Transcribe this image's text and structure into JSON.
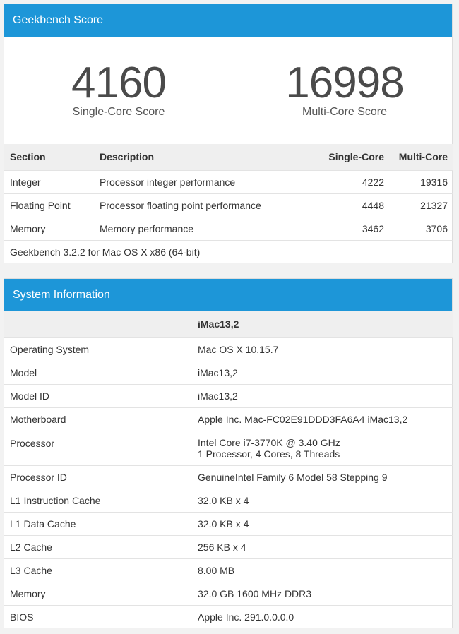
{
  "score_panel": {
    "title": "Geekbench Score",
    "single": {
      "value": "4160",
      "label": "Single-Core Score"
    },
    "multi": {
      "value": "16998",
      "label": "Multi-Core Score"
    },
    "columns": [
      "Section",
      "Description",
      "Single-Core",
      "Multi-Core"
    ],
    "rows": [
      {
        "section": "Integer",
        "description": "Processor integer performance",
        "single": "4222",
        "multi": "19316"
      },
      {
        "section": "Floating Point",
        "description": "Processor floating point performance",
        "single": "4448",
        "multi": "21327"
      },
      {
        "section": "Memory",
        "description": "Memory performance",
        "single": "3462",
        "multi": "3706"
      }
    ],
    "footer": "Geekbench 3.2.2 for Mac OS X x86 (64-bit)"
  },
  "system_panel": {
    "title": "System Information",
    "header_value": "iMac13,2",
    "rows": [
      {
        "label": "Operating System",
        "value": "Mac OS X 10.15.7"
      },
      {
        "label": "Model",
        "value": "iMac13,2"
      },
      {
        "label": "Model ID",
        "value": "iMac13,2"
      },
      {
        "label": "Motherboard",
        "value": "Apple Inc. Mac-FC02E91DDD3FA6A4 iMac13,2"
      },
      {
        "label": "Processor",
        "value": "Intel Core i7-3770K @ 3.40 GHz",
        "value2": "1 Processor, 4 Cores, 8 Threads"
      },
      {
        "label": "Processor ID",
        "value": "GenuineIntel Family 6 Model 58 Stepping 9"
      },
      {
        "label": "L1 Instruction Cache",
        "value": "32.0 KB x 4"
      },
      {
        "label": "L1 Data Cache",
        "value": "32.0 KB x 4"
      },
      {
        "label": "L2 Cache",
        "value": "256 KB x 4"
      },
      {
        "label": "L3 Cache",
        "value": "8.00 MB"
      },
      {
        "label": "Memory",
        "value": "32.0 GB 1600 MHz DDR3"
      },
      {
        "label": "BIOS",
        "value": "Apple Inc. 291.0.0.0.0"
      }
    ]
  },
  "colors": {
    "header_bg": "#1d96d8",
    "table_header_bg": "#efefef"
  }
}
